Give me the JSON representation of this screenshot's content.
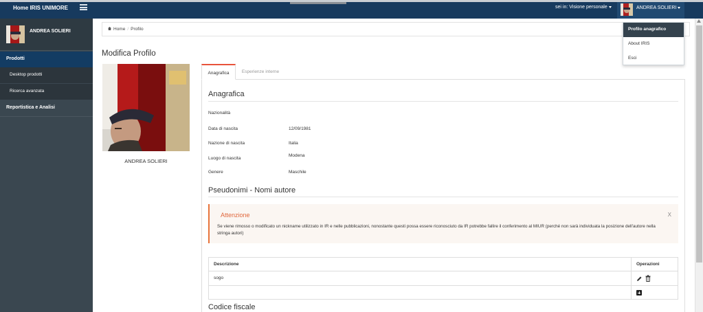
{
  "topbar": {
    "home_label": "Home IRIS UNIMORE",
    "session_label": "sei in: Visione personale",
    "user_name": "ANDREA SOLIERI"
  },
  "user_menu": {
    "items": [
      {
        "label": "Profilo anagrafico",
        "active": true
      },
      {
        "label": "About IRIS",
        "active": false
      },
      {
        "label": "Esci",
        "active": false
      }
    ]
  },
  "sidebar": {
    "user_name": "ANDREA SOLIERI",
    "items": [
      {
        "label": "Prodotti",
        "active": true
      },
      {
        "label": "Desktop prodotti"
      },
      {
        "label": "Ricerca avanzata"
      },
      {
        "label": "Reportistica e Analisi"
      }
    ]
  },
  "breadcrumb": {
    "home": "Home",
    "current": "Profilo"
  },
  "page": {
    "title": "Modifica Profilo",
    "photo_caption": "ANDREA SOLIERI"
  },
  "tabs": [
    {
      "label": "Anagrafica",
      "active": true
    },
    {
      "label": "Esperienze interne",
      "active": false
    }
  ],
  "anagrafica": {
    "title": "Anagrafica",
    "fields": [
      {
        "label": "Nazionalità",
        "value": ""
      },
      {
        "label": "Data di nascita",
        "value": "12/09/1981"
      },
      {
        "label": "Nazione di nascita",
        "value": "Italia"
      },
      {
        "label": "Luogo di nascita",
        "value": "Modena"
      },
      {
        "label": "Genere",
        "value": "Maschile"
      }
    ]
  },
  "pseudonimi": {
    "title": "Pseudonimi - Nomi autore",
    "alert_title": "Attenzione",
    "alert_text": "Se viene rimosso o modificato un nickname utilizzato in IR e nelle pubblicazioni, nonostante questi possa essere riconosciuto da IR potrebbe fallire il conferimento al MIUR (perché non sarà individuata la posizione dell'autore nella stringa autori)",
    "alert_close": "X",
    "table": {
      "col_description": "Descrizione",
      "col_operations": "Operazioni",
      "rows": [
        {
          "description": "sogo"
        }
      ]
    }
  },
  "codice_fiscale": {
    "title": "Codice fiscale"
  },
  "colors": {
    "topbar": "#173a5e",
    "sidebar": "#3a4750",
    "active_nav": "#133c63",
    "accent": "#e8533a",
    "alert_text": "#e0673c"
  }
}
